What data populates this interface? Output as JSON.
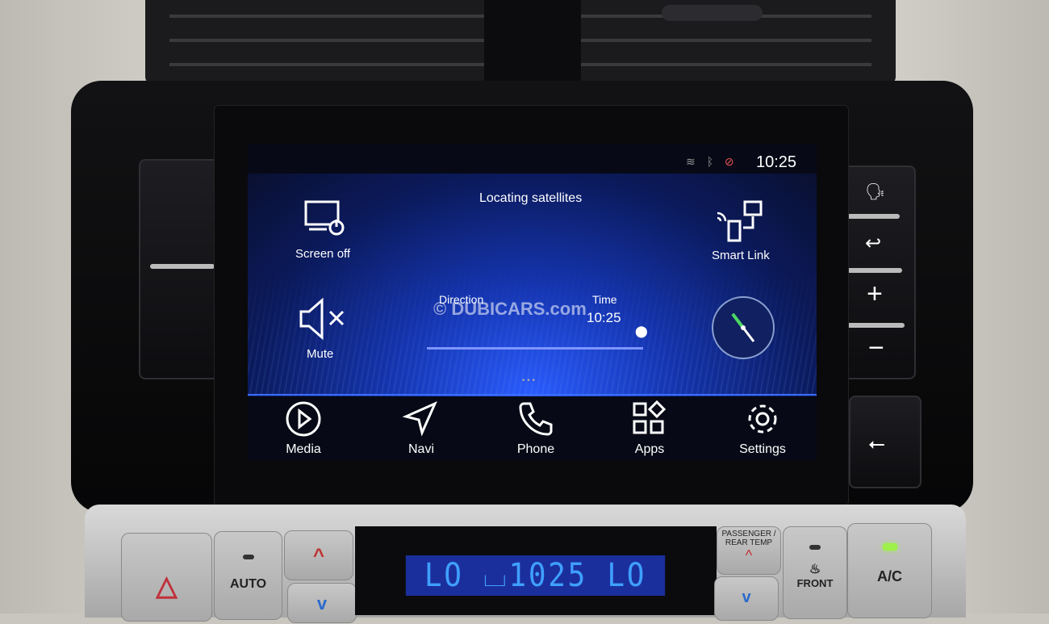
{
  "status_bar": {
    "time": "10:25",
    "icons": [
      "wifi-icon",
      "bluetooth-icon",
      "gps-off-icon"
    ]
  },
  "header": {
    "status": "Locating satellites"
  },
  "shortcuts": [
    {
      "label": "Screen off",
      "icon": "screen-off-icon"
    },
    {
      "label": "Smart Link",
      "icon": "smart-link-icon"
    },
    {
      "label": "Mute",
      "icon": "mute-icon"
    }
  ],
  "widget": {
    "direction_label": "Direction",
    "time_label": "Time",
    "time_value": "10:25"
  },
  "watermark": "© DUBICARS.com",
  "dock": [
    {
      "label": "Media",
      "icon": "play-circle-icon"
    },
    {
      "label": "Navi",
      "icon": "navigation-arrow-icon"
    },
    {
      "label": "Phone",
      "icon": "phone-icon"
    },
    {
      "label": "Apps",
      "icon": "apps-grid-icon"
    },
    {
      "label": "Settings",
      "icon": "gear-icon"
    }
  ],
  "climate": {
    "auto_label": "AUTO",
    "passenger_label": "PASSENGER / REAR TEMP",
    "front_label": "FRONT",
    "ac_label": "A/C",
    "display": "LO ⌴1025 LO",
    "colors": {
      "lcd_bg": "#1b2f9c",
      "lcd_text": "#3fa0ff",
      "ac_led": "#9ef04a"
    }
  },
  "colors": {
    "accent": "#2a5cff"
  }
}
